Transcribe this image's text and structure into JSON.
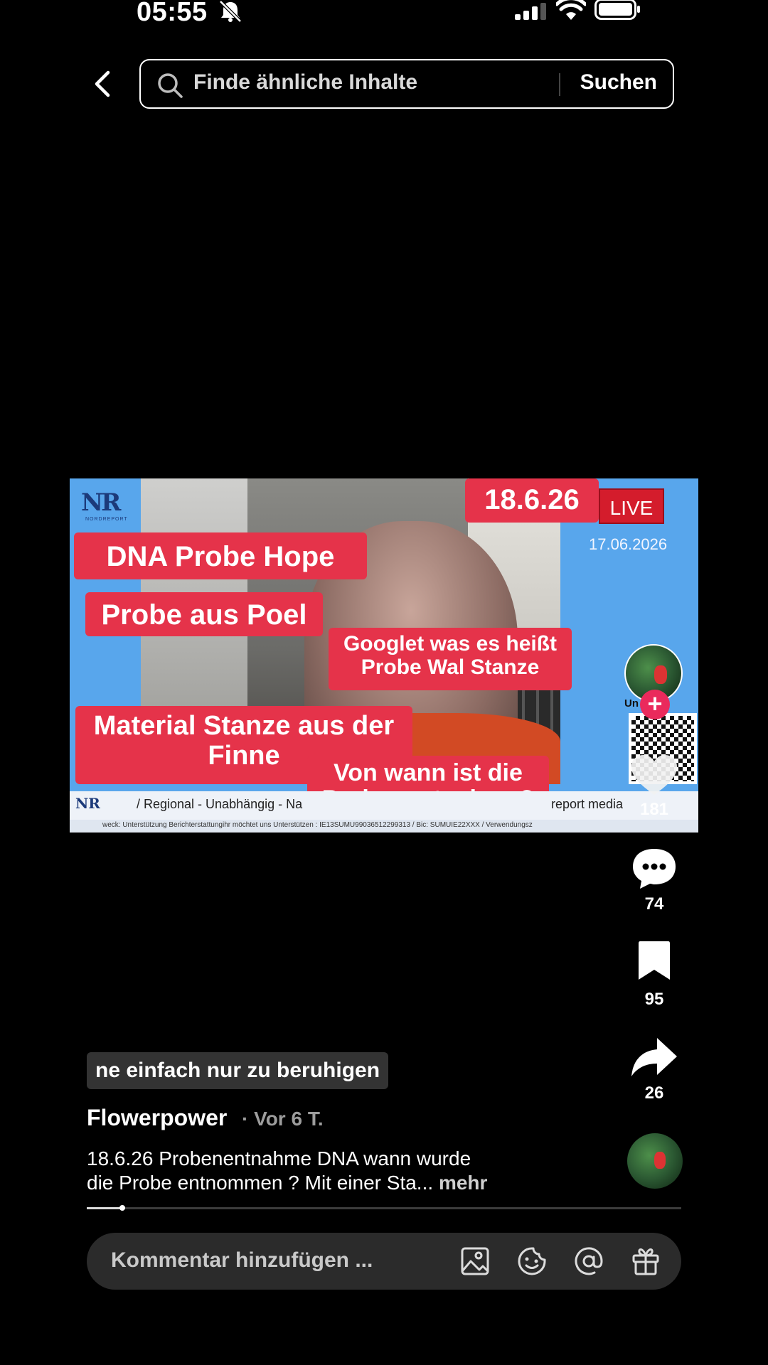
{
  "status_bar": {
    "time": "05:55"
  },
  "search": {
    "placeholder": "Finde ähnliche Inhalte",
    "button": "Suchen"
  },
  "video": {
    "date_badge": "18.6.26",
    "live_badge": "LIVE",
    "date_stamp": "17.06.2026",
    "labels": [
      "DNA Probe Hope",
      "Probe aus Poel",
      "Googlet was es heißt Probe Wal Stanze",
      "Material Stanze aus der Finne",
      "Von wann ist die Probenentnahme?"
    ],
    "ticker": "/ Regional - Unabhängig - Na",
    "ticker_brand": "report media",
    "ticker_small": "weck: Unterstützung Berichterstattungihr möchtet uns Unterstützen : IE13SUMU99036512299313 / Bic: SUMUIE22XXX / Verwendungsz",
    "qr_caption": "Un     zung",
    "logo_text": "NR",
    "logo_sub": "NORDREPORT"
  },
  "actions": {
    "likes": "181",
    "comments": "74",
    "bookmarks": "95",
    "shares": "26"
  },
  "caption": {
    "subtitle": "ne einfach nur zu beruhigen",
    "author": "Flowerpower",
    "time": "· Vor 6 T.",
    "line1": "18.6.26 Probenentnahme DNA wann wurde",
    "line2": "die Probe entnommen ? Mit einer Sta...",
    "more": "mehr"
  },
  "progress": {
    "fraction": 0.06
  },
  "comment_bar": {
    "placeholder": "Kommentar hinzufügen ..."
  },
  "colors": {
    "accent": "#ea2a5c",
    "label_red": "#e5334a",
    "video_bg": "#58a6ec"
  }
}
